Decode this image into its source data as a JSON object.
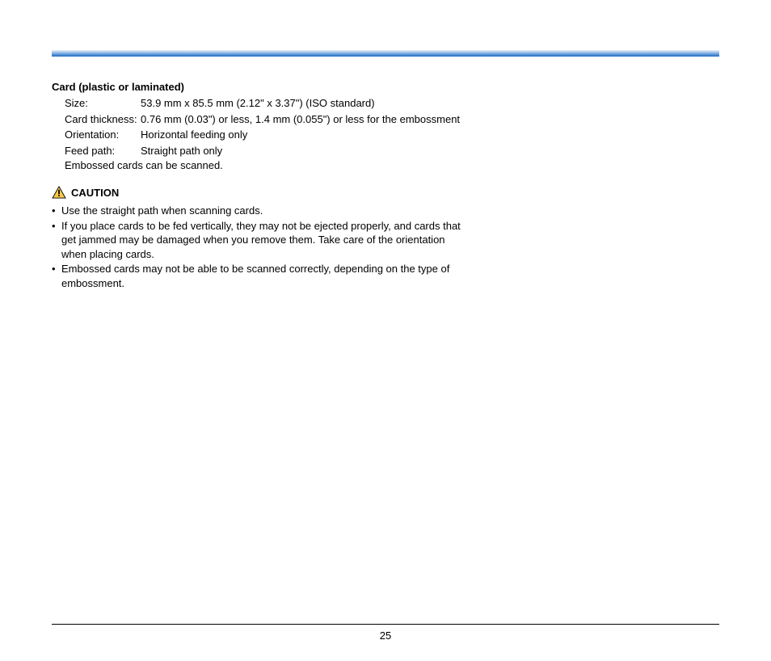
{
  "section": {
    "title": "Card (plastic or laminated)",
    "specs": {
      "size": {
        "label": "Size:",
        "value": "53.9 mm x 85.5 mm (2.12\" x 3.37\") (ISO standard)"
      },
      "thickness": {
        "label": "Card thickness:",
        "value": "0.76 mm (0.03\") or less, 1.4 mm (0.055\") or less for the embossment"
      },
      "orientation": {
        "label": "Orientation:",
        "value": "Horizontal feeding only"
      },
      "feedpath": {
        "label": "Feed path:",
        "value": "Straight path only"
      }
    },
    "note": "Embossed cards can be scanned."
  },
  "caution": {
    "label": "CAUTION",
    "items": [
      "Use the straight path when scanning cards.",
      "If you place cards to be fed vertically, they may not be ejected properly, and cards that get jammed may be damaged when you remove them. Take care of the orientation when placing cards.",
      "Embossed cards may not be able to be scanned correctly, depending on the type of embossment."
    ]
  },
  "page_number": "25"
}
